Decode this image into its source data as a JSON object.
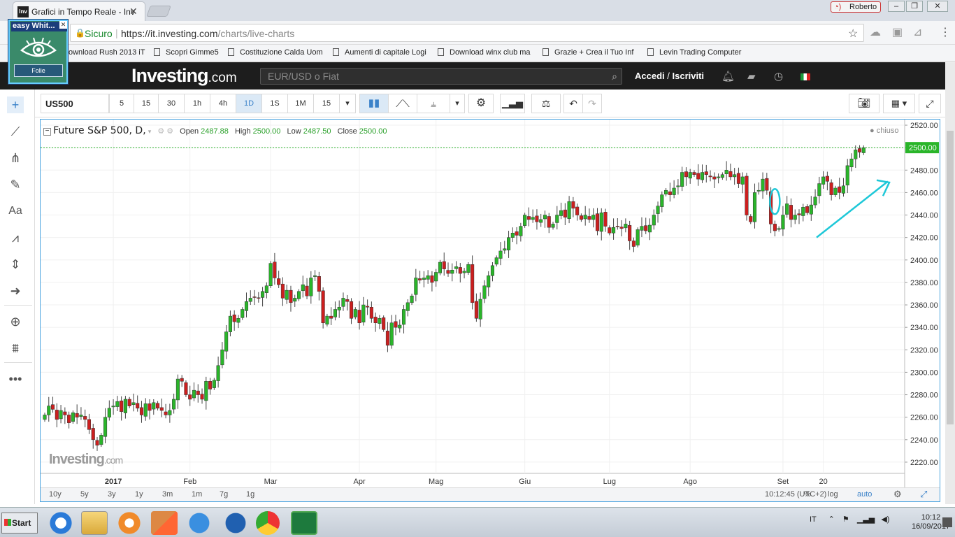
{
  "browser": {
    "tab_title": "Grafici in Tempo Reale - Inv",
    "favicon_text": "Inv",
    "user": "Roberto",
    "security": "Sicuro",
    "url_host": "https://it.investing.com",
    "url_path": "/charts/live-charts",
    "bookmarks": [
      "ownload Rush 2013 iT",
      "Scopri Gimme5",
      "Costituzione Calda Uom",
      "Aumenti di capitale Logi",
      "Download winx club ma",
      "Grazie + Crea il Tuo Inf",
      "Levin Trading Computer"
    ]
  },
  "widget": {
    "title": "easy Whit...",
    "button": "Folie"
  },
  "site": {
    "logo": "Investing",
    "logo_suffix": ".com",
    "search_placeholder": "EUR/USD o Fiat",
    "login": "Accedi",
    "register": "Iscriviti",
    "sep": "/"
  },
  "toolbar": {
    "symbol": "US500",
    "intervals": [
      "5",
      "15",
      "30",
      "1h",
      "4h",
      "1D",
      "1S",
      "1M",
      "15"
    ],
    "active_interval": "1D"
  },
  "legend": {
    "title": "Future S&P 500, D,",
    "open_label": "Open",
    "open": "2487.88",
    "high_label": "High",
    "high": "2500.00",
    "low_label": "Low",
    "low": "2487.50",
    "close_label": "Close",
    "close": "2500.00",
    "status": "chiuso"
  },
  "watermark": {
    "text": "Investing",
    "suffix": ".com"
  },
  "bottom": {
    "ranges": [
      "10y",
      "5y",
      "3y",
      "1y",
      "3m",
      "1m",
      "7g",
      "1g"
    ],
    "time": "10:12:45 (UTC+2)",
    "pct": "%",
    "log": "log",
    "auto": "auto"
  },
  "taskbar": {
    "start": "Start",
    "lang": "IT",
    "time": "10:12",
    "date": "16/09/2017"
  },
  "colors": {
    "up": "#2ab52a",
    "down": "#cc1f1f",
    "last": "#2ab52a",
    "accent": "#1ec8d8"
  },
  "chart_data": {
    "type": "candlestick",
    "title": "Future S&P 500, D,",
    "ylim": [
      2210,
      2525
    ],
    "yticks": [
      2220,
      2240,
      2260,
      2280,
      2300,
      2320,
      2340,
      2360,
      2380,
      2400,
      2420,
      2440,
      2460,
      2480,
      2500,
      2520
    ],
    "last_price": "2500.00",
    "x_labels": [
      {
        "label": "2017",
        "index": 17
      },
      {
        "label": "Feb",
        "index": 36
      },
      {
        "label": "Mar",
        "index": 56
      },
      {
        "label": "Apr",
        "index": 78
      },
      {
        "label": "Mag",
        "index": 97
      },
      {
        "label": "Giu",
        "index": 119
      },
      {
        "label": "Lug",
        "index": 140
      },
      {
        "label": "Ago",
        "index": 160
      },
      {
        "label": "Set",
        "index": 183
      },
      {
        "label": "20",
        "index": 193
      }
    ],
    "closes": [
      2262,
      2270,
      2267,
      2258,
      2266,
      2262,
      2255,
      2264,
      2260,
      2262,
      2258,
      2249,
      2240,
      2235,
      2244,
      2260,
      2268,
      2270,
      2274,
      2265,
      2276,
      2270,
      2273,
      2268,
      2262,
      2272,
      2266,
      2273,
      2268,
      2266,
      2262,
      2266,
      2276,
      2294,
      2292,
      2280,
      2276,
      2284,
      2280,
      2276,
      2292,
      2285,
      2293,
      2306,
      2320,
      2336,
      2350,
      2345,
      2348,
      2356,
      2363,
      2366,
      2367,
      2366,
      2372,
      2377,
      2397,
      2384,
      2378,
      2366,
      2373,
      2362,
      2366,
      2372,
      2378,
      2368,
      2384,
      2386,
      2372,
      2344,
      2350,
      2348,
      2356,
      2358,
      2366,
      2363,
      2348,
      2356,
      2344,
      2360,
      2358,
      2348,
      2344,
      2348,
      2338,
      2324,
      2344,
      2340,
      2342,
      2356,
      2362,
      2368,
      2384,
      2382,
      2384,
      2386,
      2380,
      2389,
      2398,
      2392,
      2388,
      2391,
      2394,
      2388,
      2390,
      2396,
      2362,
      2348,
      2365,
      2377,
      2386,
      2395,
      2402,
      2408,
      2410,
      2420,
      2424,
      2422,
      2430,
      2440,
      2436,
      2438,
      2434,
      2436,
      2440,
      2429,
      2432,
      2440,
      2444,
      2438,
      2452,
      2446,
      2440,
      2436,
      2440,
      2436,
      2440,
      2426,
      2442,
      2430,
      2424,
      2429,
      2430,
      2428,
      2432,
      2417,
      2412,
      2427,
      2430,
      2426,
      2431,
      2440,
      2448,
      2458,
      2462,
      2458,
      2464,
      2466,
      2478,
      2474,
      2478,
      2476,
      2472,
      2478,
      2476,
      2474,
      2472,
      2474,
      2476,
      2480,
      2474,
      2476,
      2468,
      2474,
      2440,
      2434,
      2460,
      2462,
      2472,
      2462,
      2432,
      2426,
      2428,
      2440,
      2450,
      2436,
      2440,
      2440,
      2447,
      2442,
      2449,
      2456,
      2468,
      2474,
      2470,
      2458,
      2464,
      2460,
      2466,
      2484,
      2490,
      2498,
      2496,
      2500
    ]
  }
}
